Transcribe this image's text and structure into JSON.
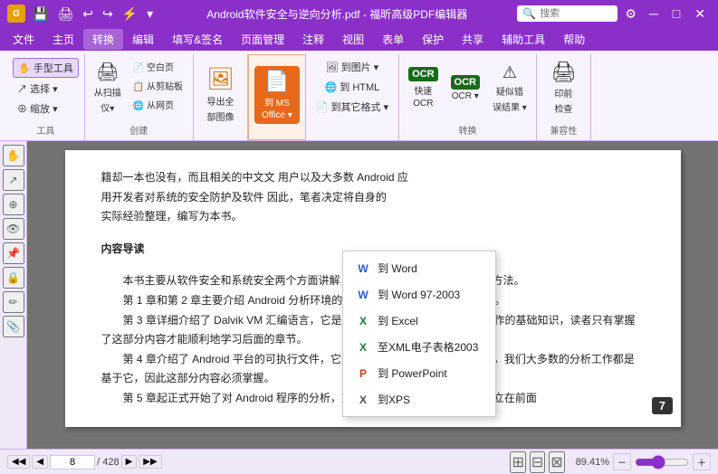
{
  "titleBar": {
    "appIcon": "G",
    "title": "Android软件安全与逆向分析.pdf - 福昕高级PDF编辑器",
    "quickTools": [
      "💾",
      "🖨",
      "↩",
      "↪",
      "⚡"
    ],
    "winButtons": [
      "─",
      "□",
      "✕"
    ]
  },
  "menuBar": {
    "items": [
      "文件",
      "主页",
      "转换",
      "编辑",
      "填写&签名",
      "页面管理",
      "注释",
      "视图",
      "表单",
      "保护",
      "共享",
      "辅助工具",
      "帮助"
    ]
  },
  "ribbon": {
    "activeTab": "转换",
    "groups": [
      {
        "label": "工具",
        "items": [
          "手型工具",
          "选择▾",
          "缩放▾"
        ]
      },
      {
        "label": "创建",
        "items": [
          "从扫描仪▾",
          "空白页",
          "从剪贴板",
          "从网页"
        ]
      },
      {
        "label": "",
        "items": [
          "导出全部图像"
        ]
      },
      {
        "label": "",
        "items": [
          "到 MS Office▾"
        ]
      },
      {
        "label": "",
        "items": [
          "到图片▾",
          "到 HTML",
          "到其它格式▾"
        ]
      },
      {
        "label": "转换",
        "items": [
          "快速OCR",
          "OCR▾",
          "疑似错误结果▾"
        ]
      },
      {
        "label": "兼容性",
        "items": [
          "印前检查"
        ]
      }
    ],
    "searchPlaceholder": "搜索"
  },
  "dropdown": {
    "items": [
      {
        "icon": "W",
        "label": "到 Word",
        "highlighted": false
      },
      {
        "icon": "W",
        "label": "到 Word 97-2003",
        "highlighted": false
      },
      {
        "icon": "X",
        "label": "到 Excel",
        "highlighted": false
      },
      {
        "icon": "X",
        "label": "至XML电子表格2003",
        "highlighted": false
      },
      {
        "icon": "P",
        "label": "到 PowerPoint",
        "highlighted": false
      },
      {
        "icon": "X",
        "label": "到XPS",
        "highlighted": false
      }
    ]
  },
  "document": {
    "paragraphs": [
      "籍却一本也没有，而且相关的中文文      用户以及大多数 Android 应",
      "用开发者对系统的安全防护及软件      因此，笔者决定将自身的",
      "实际经验整理，编写为本书。"
    ],
    "sectionTitle": "内容导读",
    "bodyText": [
      "本书主要从软件安全和系统安全两个方面讲解 Android 平台存在的攻与防范方法。",
      "第 1 章和第 2 章主要介绍 Android 分析环境的搭建与 Android 程序的分析方法。",
      "第 3 章详细介绍了 Dalvik VM 汇编语言，它是 Android 平台上进行安全分析工作的基础知识，读者只有掌握了这部分内容才能顺利地学习后面的章节。",
      "第 4 章介绍了 Android 平台的可执行文件，它是 Android 软件得以运行的基石，我们大多数的分析工作都是基于它，因此这部分内容必须掌握。",
      "第 5 章起正式开始了对 Android 程序的分析，对这部分的理解与运用完全是建立在前面"
    ]
  },
  "statusBar": {
    "navFirst": "◀◀",
    "navPrev": "◀",
    "currentPage": "8",
    "totalPages": "428",
    "navNext": "▶",
    "navLast": "▶▶",
    "pageNumBadge": "7",
    "zoom": "89.41%",
    "zoomOut": "－",
    "zoomIn": "＋",
    "icons": [
      "⊞",
      "⊟",
      "⊠"
    ]
  },
  "leftToolbar": {
    "items": [
      "✋",
      "↗",
      "⊕",
      "👁",
      "📌",
      "🔒",
      "✏",
      "📎"
    ]
  }
}
